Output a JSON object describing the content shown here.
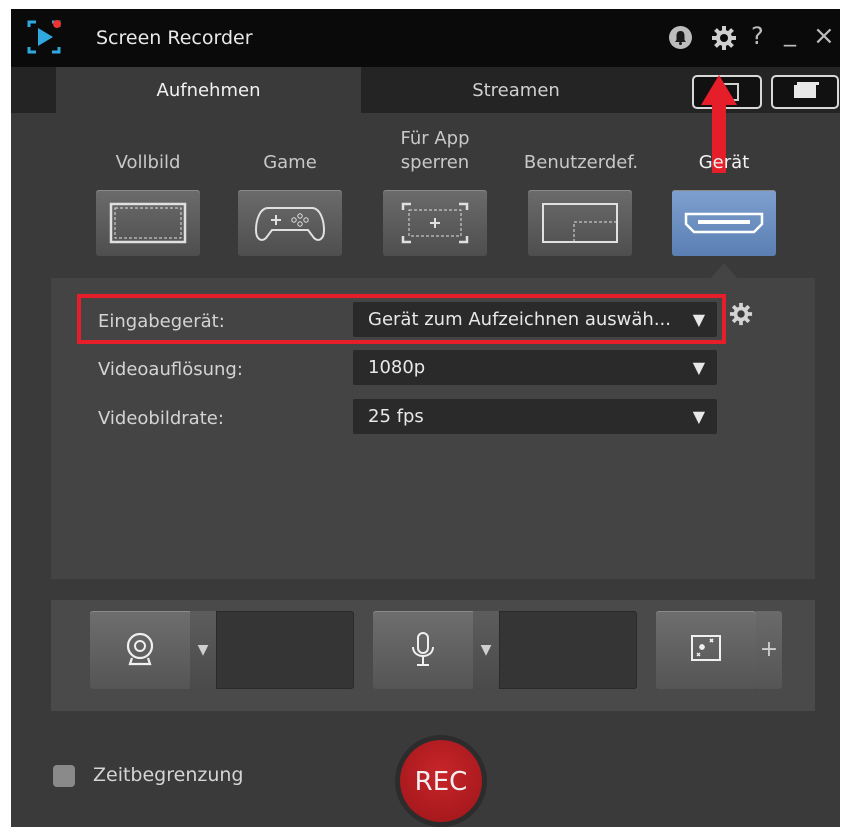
{
  "window": {
    "title": "Screen Recorder",
    "icons": [
      "notification-bell-icon",
      "settings-gear-icon",
      "help-icon",
      "minimize-icon",
      "close-icon"
    ],
    "help_glyph": "?",
    "minimize_glyph": "_",
    "close_glyph": "×"
  },
  "tabs": [
    {
      "label": "Aufnehmen",
      "active": true
    },
    {
      "label": "Streamen",
      "active": false
    }
  ],
  "modes": [
    {
      "label": "Vollbild",
      "icon": "fullscreen-icon",
      "selected": false
    },
    {
      "label": "Game",
      "icon": "gamepad-icon",
      "selected": false
    },
    {
      "label": "Für App sperren",
      "line1": "Für App",
      "line2": "sperren",
      "icon": "app-lock-icon",
      "selected": false
    },
    {
      "label": "Benutzerdef.",
      "icon": "custom-area-icon",
      "selected": false
    },
    {
      "label": "Gerät",
      "icon": "hdmi-device-icon",
      "selected": true
    }
  ],
  "settings": {
    "input_device": {
      "label": "Eingabegerät:",
      "value": "Gerät zum Aufzeichnen auswäh..."
    },
    "resolution": {
      "label": "Videoauflösung:",
      "value": "1080p"
    },
    "framerate": {
      "label": "Videobildrate:",
      "value": "25 fps"
    }
  },
  "sources": {
    "webcam_icon": "webcam-icon",
    "mic_icon": "microphone-icon",
    "effects_icon": "effects-sparkle-icon",
    "add_glyph": "+",
    "dropdown_glyph": "▼"
  },
  "footer": {
    "time_limit_label": "Zeitbegrenzung",
    "time_limit_checked": false,
    "rec_label": "REC"
  },
  "colors": {
    "accent_selected": "#6e90c4",
    "rec": "#b71c1f",
    "annotation_red": "#e61e2a"
  }
}
